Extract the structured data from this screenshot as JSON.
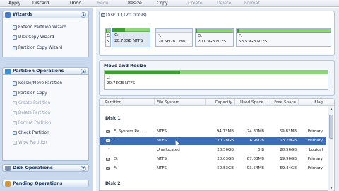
{
  "toolbar": {
    "items": [
      {
        "label": "Apply",
        "enabled": true
      },
      {
        "label": "Discard",
        "enabled": true
      },
      {
        "label": "Undo",
        "enabled": true
      },
      {
        "label": "Redo",
        "enabled": false
      },
      {
        "label": "Resize",
        "enabled": true
      },
      {
        "label": "Copy",
        "enabled": true
      },
      {
        "label": "Create",
        "enabled": false
      },
      {
        "label": "Delete",
        "enabled": false
      },
      {
        "label": "Format",
        "enabled": false
      }
    ]
  },
  "sidebar": {
    "wizards": {
      "title": "Wizards",
      "items": [
        "Extend Partition Wizard",
        "Disk Copy Wizard",
        "Partition Copy Wizard"
      ]
    },
    "partition_operations": {
      "title": "Partition Operations",
      "items": [
        {
          "label": "Resize/Move Partition",
          "enabled": true
        },
        {
          "label": "Partition Copy",
          "enabled": true
        },
        {
          "label": "Create Partition",
          "enabled": false
        },
        {
          "label": "Delete Partition",
          "enabled": false
        },
        {
          "label": "Format Partition",
          "enabled": false
        },
        {
          "label": "Check Partition",
          "enabled": true
        },
        {
          "label": "Wipe Partition",
          "enabled": false
        }
      ]
    },
    "disk_operations": {
      "title": "Disk Operations"
    },
    "pending_operations": {
      "title": "Pending Operations"
    }
  },
  "disk_map": {
    "title": "Disk 1 (120.00GB)",
    "partitions": [
      {
        "line1": "E:",
        "line2": "5"
      },
      {
        "line1": "C:",
        "line2": "20.78GB NTFS",
        "selected": true
      },
      {
        "line1": "*:",
        "line2": "20.56GB Unall..."
      },
      {
        "line1": "D:",
        "line2": "20.03GB NTFS"
      },
      {
        "line1": "F:",
        "line2": "58.53GB NTFS"
      }
    ]
  },
  "move_resize": {
    "title": "Move and Resize",
    "partition": {
      "line1": "C:",
      "line2": "20.78GB NTFS"
    }
  },
  "table": {
    "columns": [
      "Partition",
      "File System",
      "Capacity",
      "Used Space",
      "Free Space",
      "Flag"
    ],
    "groups": [
      {
        "name": "Disk 1",
        "rows": [
          {
            "partition": "E: System Re...",
            "fs": "NTFS",
            "capacity": "94.13MB",
            "used": "24.30MB",
            "free": "69.83MB",
            "flag": "Primary"
          },
          {
            "partition": "C:",
            "fs": "NTFS",
            "capacity": "20.78GB",
            "used": "6.99GB",
            "free": "13.79GB",
            "flag": "Primary",
            "selected": true
          },
          {
            "partition": "*",
            "fs": "Unallocated",
            "capacity": "20.56GB",
            "used": "0 B",
            "free": "20.56GB",
            "flag": "Logical"
          },
          {
            "partition": "D:",
            "fs": "NTFS",
            "capacity": "20.03GB",
            "used": "67.03MB",
            "free": "19.96GB",
            "flag": "Primary"
          },
          {
            "partition": "F:",
            "fs": "NTFS",
            "capacity": "59.53GB",
            "used": "93.54MB",
            "free": "59.44GB",
            "flag": "Primary"
          }
        ]
      },
      {
        "name": "Disk 2",
        "rows": []
      }
    ]
  },
  "colors": {
    "selection": "#3d6db4",
    "used_bar": "#3f9d33",
    "free_bar": "#8fd47a",
    "sidebar_bg": "#c9d8ec"
  }
}
